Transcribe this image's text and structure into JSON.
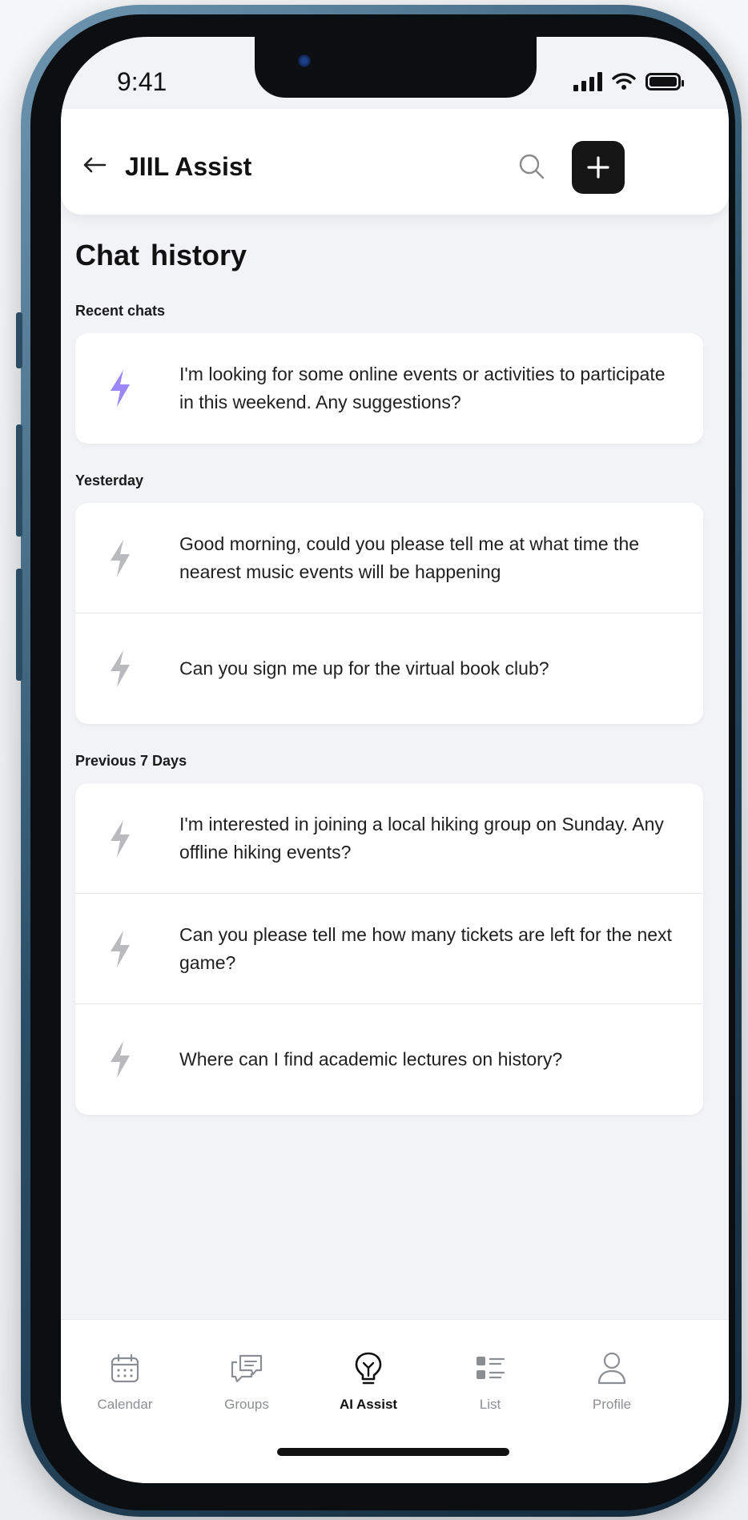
{
  "status_bar": {
    "time": "9:41"
  },
  "header": {
    "title": "JIIL Assist",
    "back_icon": "arrow-left-icon",
    "search_icon": "search-icon",
    "add_icon": "plus-icon"
  },
  "page": {
    "title": "Chat  history"
  },
  "sections": [
    {
      "label": "Recent chats",
      "items": [
        {
          "text": "I'm looking for some online events or activities to participate in this weekend. Any suggestions?",
          "icon": "lightning-icon",
          "icon_color": "#9b87f5"
        }
      ]
    },
    {
      "label": "Yesterday",
      "items": [
        {
          "text": "Good morning, could you please tell me at what time the nearest music events will be happening",
          "icon": "lightning-icon",
          "icon_color": "#b9babd"
        },
        {
          "text": "Can you sign me up for the virtual book club?",
          "icon": "lightning-icon",
          "icon_color": "#b9babd"
        }
      ]
    },
    {
      "label": "Previous 7 Days",
      "items": [
        {
          "text": "I'm interested in joining a local hiking group on Sunday. Any offline hiking events?",
          "icon": "lightning-icon",
          "icon_color": "#b9babd"
        },
        {
          "text": "Can you please tell me how many tickets are left for the next game?",
          "icon": "lightning-icon",
          "icon_color": "#b9babd"
        },
        {
          "text": "Where can I find academic lectures on history?",
          "icon": "lightning-icon",
          "icon_color": "#b9babd"
        }
      ]
    }
  ],
  "tabs": [
    {
      "label": "Calendar",
      "icon": "calendar-icon",
      "active": false
    },
    {
      "label": "Groups",
      "icon": "chat-bubbles-icon",
      "active": false
    },
    {
      "label": "AI Assist",
      "icon": "lightbulb-icon",
      "active": true
    },
    {
      "label": "List",
      "icon": "list-icon",
      "active": false
    },
    {
      "label": "Profile",
      "icon": "person-icon",
      "active": false
    }
  ],
  "colors": {
    "accent": "#9b87f5",
    "inactive_icon": "#b9babd",
    "dark": "#161616"
  }
}
